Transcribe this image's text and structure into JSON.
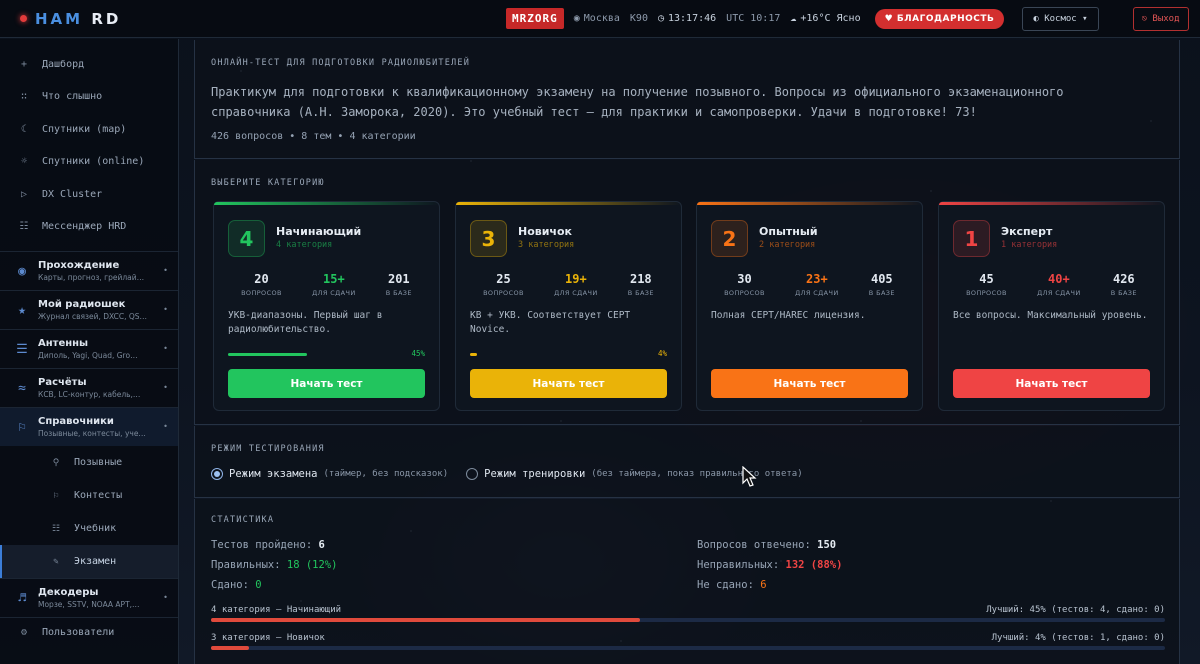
{
  "header": {
    "logo_a": "HAM",
    "logo_b": "RD",
    "callsign": "MRZORG",
    "city": "Москва",
    "locator": "K90",
    "local_time": "13:17:46",
    "utc": "UTC 10:17",
    "weather": "+16°C Ясно",
    "thanks_label": "БЛАГОДАРНОСТЬ",
    "theme_label": "Космос",
    "logout_label": "Выход"
  },
  "sidebar": {
    "items": [
      {
        "label": "Дашборд",
        "icon": "plus-icon"
      },
      {
        "label": "Что слышно",
        "icon": "dots-icon"
      },
      {
        "label": "Спутники (map)",
        "icon": "moon-icon"
      },
      {
        "label": "Спутники (online)",
        "icon": "sun-icon"
      },
      {
        "label": "DX Cluster",
        "icon": "play-icon"
      },
      {
        "label": "Мессенджер HRD",
        "icon": "list-icon"
      }
    ],
    "groups": [
      {
        "title": "Прохождение",
        "sub": "Карты, прогноз, грейлай…"
      },
      {
        "title": "Мой радиошек",
        "sub": "Журнал связей, DXCC, QS…"
      },
      {
        "title": "Антенны",
        "sub": "Диполь, Yagi, Quad, Gro…"
      },
      {
        "title": "Расчёты",
        "sub": "КСВ, LC-контур, кабель,…"
      },
      {
        "title": "Справочники",
        "sub": "Позывные, контесты, уче…"
      }
    ],
    "subitems": [
      "Позывные",
      "Контесты",
      "Учебник",
      "Экзамен"
    ],
    "decoders": {
      "title": "Декодеры",
      "sub": "Морзе, SSTV, NOAA APT,…"
    },
    "users": "Пользователи"
  },
  "intro": {
    "title": "ОНЛАЙН-ТЕСТ ДЛЯ ПОДГОТОВКИ РАДИОЛЮБИТЕЛЕЙ",
    "description": "Практикум для подготовки к квалификационному экзамену на получение позывного. Вопросы из официального экзаменационного справочника (А.Н. Заморока, 2020). Это учебный тест — для практики и самопроверки. Удачи в подготовке! 73!",
    "meta": "426 вопросов • 8 тем • 4 категории"
  },
  "categories": {
    "title": "ВЫБЕРИТЕ КАТЕГОРИЮ",
    "stat_labels": [
      "ВОПРОСОВ",
      "ДЛЯ СДАЧИ",
      "В БАЗЕ"
    ],
    "start_label": "Начать тест",
    "cards": [
      {
        "num": "4",
        "name": "Начинающий",
        "cat": "4 категория",
        "q": "20",
        "pass": "15+",
        "base": "201",
        "desc": "УКВ-диапазоны. Первый шаг в радиолюбительство.",
        "progress": 45,
        "progress_label": "45%",
        "color": "#22c55e"
      },
      {
        "num": "3",
        "name": "Новичок",
        "cat": "3 категория",
        "q": "25",
        "pass": "19+",
        "base": "218",
        "desc": "КВ + УКВ. Соответствует CEPT Novice.",
        "progress": 4,
        "progress_label": "4%",
        "color": "#eab308"
      },
      {
        "num": "2",
        "name": "Опытный",
        "cat": "2 категория",
        "q": "30",
        "pass": "23+",
        "base": "405",
        "desc": "Полная CEPT/HAREC лицензия.",
        "progress": null,
        "progress_label": "",
        "color": "#f97316"
      },
      {
        "num": "1",
        "name": "Эксперт",
        "cat": "1 категория",
        "q": "45",
        "pass": "40+",
        "base": "426",
        "desc": "Все вопросы. Максимальный уровень.",
        "progress": null,
        "progress_label": "",
        "color": "#ef4444"
      }
    ]
  },
  "mode": {
    "title": "РЕЖИМ ТЕСТИРОВАНИЯ",
    "exam_label": "Режим экзамена",
    "exam_hint": "(таймер, без подсказок)",
    "train_label": "Режим тренировки",
    "train_hint": "(без таймера, показ правильного ответа)"
  },
  "stats": {
    "title": "СТАТИСТИКА",
    "tests_label": "Тестов пройдено:",
    "tests": "6",
    "correct_label": "Правильных:",
    "correct": "18 (12%)",
    "passed_label": "Сдано:",
    "passed": "0",
    "answered_label": "Вопросов отвечено:",
    "answered": "150",
    "wrong_label": "Неправильных:",
    "wrong": "132 (88%)",
    "failed_label": "Не сдано:",
    "failed": "6",
    "bars": [
      {
        "label": "4 категория — Начинающий",
        "best": "Лучший: 45% (тестов: 4, сдано: 0)",
        "value": 45
      },
      {
        "label": "3 категория — Новичок",
        "best": "Лучший: 4% (тестов: 1, сдано: 0)",
        "value": 4
      }
    ]
  }
}
